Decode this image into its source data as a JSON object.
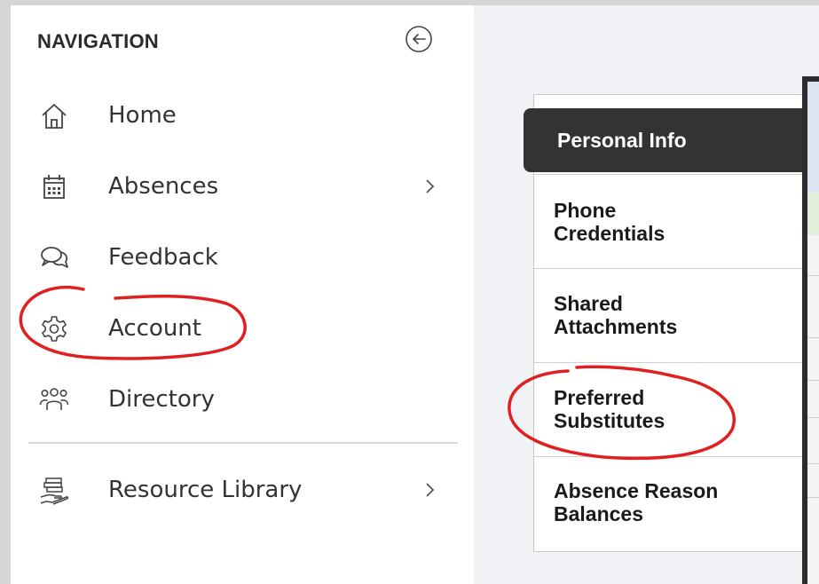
{
  "sidebar": {
    "header": "NAVIGATION",
    "collapse_icon": "arrow-left-circle-icon",
    "items": [
      {
        "label": "Home",
        "icon": "home-icon"
      },
      {
        "label": "Absences",
        "icon": "calendar-icon",
        "has_submenu": true
      },
      {
        "label": "Feedback",
        "icon": "chat-bubbles-icon"
      },
      {
        "label": "Account",
        "icon": "gear-icon"
      },
      {
        "label": "Directory",
        "icon": "people-icon"
      },
      {
        "label": "Resource Library",
        "icon": "books-in-hand-icon",
        "has_submenu": true
      }
    ]
  },
  "account_menu": {
    "active": "Personal Info",
    "items": [
      {
        "label": "Phone\nCredentials"
      },
      {
        "label": "Shared\nAttachments"
      },
      {
        "label": "Preferred\nSubstitutes"
      },
      {
        "label": "Absence Reason\nBalances"
      }
    ]
  },
  "colors": {
    "annotation_red": "#e02020",
    "active_tab_bg": "#333333",
    "page_bg": "#f1f2f6"
  }
}
